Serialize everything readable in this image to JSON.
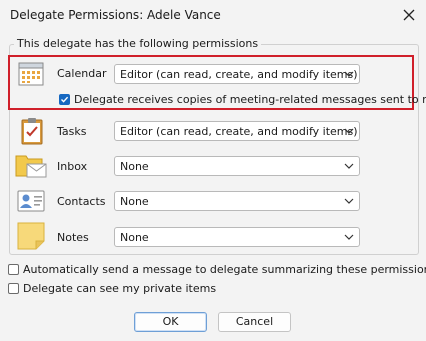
{
  "window": {
    "title": "Delegate Permissions: Adele Vance"
  },
  "group_title": "This delegate has the following permissions",
  "rows": [
    {
      "label": "Calendar",
      "value": "Editor (can read, create, and modify items)",
      "icon": "calendar-icon"
    },
    {
      "label": "Tasks",
      "value": "Editor (can read, create, and modify items)",
      "icon": "tasks-clipboard-icon"
    },
    {
      "label": "Inbox",
      "value": "None",
      "icon": "inbox-folder-envelope-icon"
    },
    {
      "label": "Contacts",
      "value": "None",
      "icon": "contact-card-icon"
    },
    {
      "label": "Notes",
      "value": "None",
      "icon": "sticky-note-icon"
    }
  ],
  "calendar_option": {
    "label": "Delegate receives copies of meeting-related messages sent to me",
    "checked": true
  },
  "options": [
    {
      "label": "Automatically send a message to delegate summarizing these permissions",
      "checked": false
    },
    {
      "label": "Delegate can see my private items",
      "checked": false
    }
  ],
  "buttons": {
    "ok": "OK",
    "cancel": "Cancel"
  },
  "colors": {
    "highlight": "#d01f2a",
    "checkbox_accent": "#1668c1"
  }
}
